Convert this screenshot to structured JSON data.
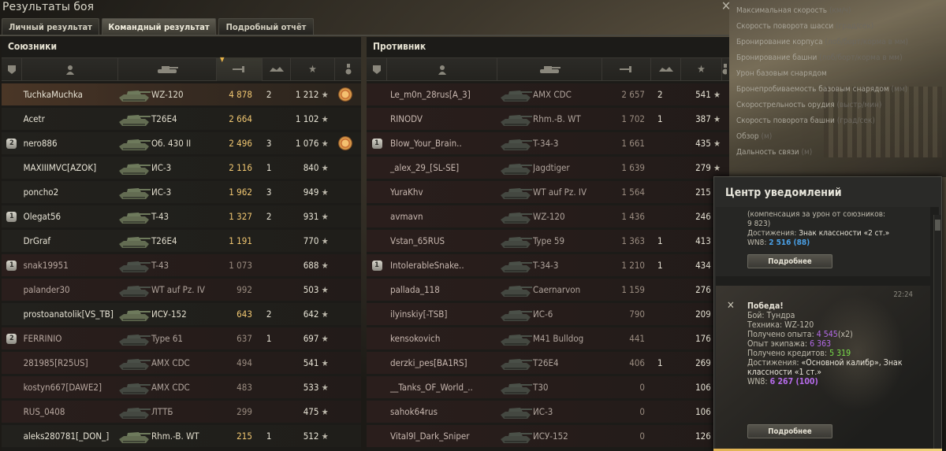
{
  "window": {
    "title": "Результаты боя",
    "close_icon": "✕"
  },
  "tabs": [
    {
      "label": "Личный результат"
    },
    {
      "label": "Командный результат",
      "active": true
    },
    {
      "label": "Подробный отчёт"
    }
  ],
  "allies": {
    "title": "Союзники",
    "rows": [
      {
        "name": "TuchkaMuchka",
        "vehicle": "WZ-120",
        "damage": "4 878",
        "kills": "2",
        "xp": "1 212",
        "badge": "",
        "medal": true,
        "highlight": "me"
      },
      {
        "name": "Acetr",
        "vehicle": "T26E4",
        "damage": "2 664",
        "kills": "",
        "xp": "1 102",
        "badge": "",
        "medal": false,
        "highlight": ""
      },
      {
        "name": "nero886",
        "vehicle": "Об. 430 II",
        "damage": "2 496",
        "kills": "3",
        "xp": "1 076",
        "badge": "2",
        "medal": true,
        "highlight": ""
      },
      {
        "name": "MAXIIIMVC[AZOK]",
        "vehicle": "ИС-3",
        "damage": "2 116",
        "kills": "1",
        "xp": "840",
        "badge": "",
        "medal": false,
        "highlight": ""
      },
      {
        "name": "poncho2",
        "vehicle": "ИС-3",
        "damage": "1 962",
        "kills": "3",
        "xp": "949",
        "badge": "",
        "medal": false,
        "highlight": ""
      },
      {
        "name": "Olegat56",
        "vehicle": "T-43",
        "damage": "1 327",
        "kills": "2",
        "xp": "931",
        "badge": "1",
        "medal": false,
        "highlight": ""
      },
      {
        "name": "DrGraf",
        "vehicle": "T26E4",
        "damage": "1 191",
        "kills": "",
        "xp": "770",
        "badge": "",
        "medal": false,
        "highlight": ""
      },
      {
        "name": "snak19951",
        "vehicle": "T-43",
        "damage": "1 073",
        "kills": "",
        "xp": "688",
        "badge": "1",
        "medal": false,
        "highlight": "dead"
      },
      {
        "name": "palander30",
        "vehicle": "WT auf Pz. IV",
        "damage": "992",
        "kills": "",
        "xp": "503",
        "badge": "",
        "medal": false,
        "highlight": "dead"
      },
      {
        "name": "prostoanatolik[VS_TB]",
        "vehicle": "ИСУ-152",
        "damage": "643",
        "kills": "2",
        "xp": "642",
        "badge": "",
        "medal": false,
        "highlight": ""
      },
      {
        "name": "FERRINIO",
        "vehicle": "Type 61",
        "damage": "637",
        "kills": "1",
        "xp": "697",
        "badge": "2",
        "medal": false,
        "highlight": "dead"
      },
      {
        "name": "281985[R25US]",
        "vehicle": "AMX CDC",
        "damage": "494",
        "kills": "",
        "xp": "541",
        "badge": "",
        "medal": false,
        "highlight": "dead"
      },
      {
        "name": "kostyn667[DAWE2]",
        "vehicle": "AMX CDC",
        "damage": "483",
        "kills": "",
        "xp": "533",
        "badge": "",
        "medal": false,
        "highlight": "dead"
      },
      {
        "name": "RUS_0408",
        "vehicle": "ЛТТБ",
        "damage": "299",
        "kills": "",
        "xp": "475",
        "badge": "",
        "medal": false,
        "highlight": "dead"
      },
      {
        "name": "aleks280781[_DON_]",
        "vehicle": "Rhm.-B. WT",
        "damage": "215",
        "kills": "1",
        "xp": "512",
        "badge": "",
        "medal": false,
        "highlight": ""
      }
    ]
  },
  "enemies": {
    "title": "Противник",
    "rows": [
      {
        "name": "Le_m0n_28rus[A_3]",
        "vehicle": "AMX CDC",
        "damage": "2 657",
        "kills": "2",
        "xp": "541",
        "badge": "",
        "highlight": "dead"
      },
      {
        "name": "RINODV",
        "vehicle": "Rhm.-B. WT",
        "damage": "1 702",
        "kills": "1",
        "xp": "387",
        "badge": "",
        "highlight": "dead"
      },
      {
        "name": "Blow_Your_Brain..",
        "vehicle": "T-34-3",
        "damage": "1 661",
        "kills": "",
        "xp": "435",
        "badge": "1",
        "highlight": "dead"
      },
      {
        "name": "_alex_29_[SL-SE]",
        "vehicle": "Jagdtiger",
        "damage": "1 639",
        "kills": "",
        "xp": "279",
        "badge": "",
        "highlight": "dead"
      },
      {
        "name": "YuraKhv",
        "vehicle": "WT auf Pz. IV",
        "damage": "1 564",
        "kills": "",
        "xp": "215",
        "badge": "",
        "highlight": "dead"
      },
      {
        "name": "avmavn",
        "vehicle": "WZ-120",
        "damage": "1 436",
        "kills": "",
        "xp": "246",
        "badge": "",
        "highlight": "dead"
      },
      {
        "name": "Vstan_65RUS",
        "vehicle": "Type 59",
        "damage": "1 363",
        "kills": "1",
        "xp": "413",
        "badge": "",
        "highlight": "dead"
      },
      {
        "name": "IntolerableSnake..",
        "vehicle": "T-34-3",
        "damage": "1 210",
        "kills": "1",
        "xp": "434",
        "badge": "1",
        "highlight": "dead"
      },
      {
        "name": "pallada_118",
        "vehicle": "Caernarvon",
        "damage": "1 159",
        "kills": "",
        "xp": "276",
        "badge": "",
        "highlight": "dead"
      },
      {
        "name": "ilyinskiy[-TSB]",
        "vehicle": "ИС-6",
        "damage": "790",
        "kills": "",
        "xp": "209",
        "badge": "",
        "highlight": "dead"
      },
      {
        "name": "kensokovich",
        "vehicle": "M41 Bulldog",
        "damage": "441",
        "kills": "",
        "xp": "176",
        "badge": "",
        "highlight": "dead"
      },
      {
        "name": "derzki_pes[BA1RS]",
        "vehicle": "T26E4",
        "damage": "406",
        "kills": "1",
        "xp": "269",
        "badge": "",
        "highlight": "dead"
      },
      {
        "name": "__Tanks_OF_World_..",
        "vehicle": "T30",
        "damage": "0",
        "kills": "",
        "xp": "106",
        "badge": "",
        "highlight": "dead"
      },
      {
        "name": "sahok64rus",
        "vehicle": "ИС-3",
        "damage": "0",
        "kills": "",
        "xp": "106",
        "badge": "",
        "highlight": "dead"
      },
      {
        "name": "Vital9l_Dark_Sniper",
        "vehicle": "ИСУ-152",
        "damage": "0",
        "kills": "",
        "xp": "126",
        "badge": "",
        "highlight": "dead"
      }
    ]
  },
  "stats_list": [
    {
      "label": "Максимальная скорость",
      "unit": "(км/ч)"
    },
    {
      "label": "Скорость поворота шасси",
      "unit": "(град/сек)"
    },
    {
      "label": "Бронирование корпуса",
      "unit": "(лоб/борт/корма в мм)"
    },
    {
      "label": "Бронирование башни",
      "unit": "(лоб/борт/корма в мм)"
    },
    {
      "label": "Урон базовым снарядом",
      "unit": ""
    },
    {
      "label": "Бронепробиваемость базовым снарядом",
      "unit": "(мм)"
    },
    {
      "label": "Скорострельность орудия",
      "unit": "(выстр/мин)"
    },
    {
      "label": "Скорость поворота башни",
      "unit": "(град/сек)"
    },
    {
      "label": "Обзор",
      "unit": "(м)"
    },
    {
      "label": "Дальность связи",
      "unit": "(м)"
    }
  ],
  "notifications": {
    "title": "Центр уведомлений",
    "msg1": {
      "line1": "(компенсация за урон от союзников:",
      "line2": "9 823)",
      "achievements_label": "Достижения:",
      "achievements": "Знак классности «2 ст.»",
      "wn8_label": "WN8:",
      "wn8": "2 516 (88)",
      "button": "Подробнее"
    },
    "msg2": {
      "time": "22:24",
      "title": "Победа!",
      "battle_label": "Бой:",
      "battle": "Тундра",
      "vehicle_label": "Техника:",
      "vehicle": "WZ-120",
      "xp_label": "Получено опыта:",
      "xp": "4 545",
      "xp_mult": "(x2)",
      "crew_label": "Опыт экипажа:",
      "crew": "6 363",
      "credits_label": "Получено кредитов:",
      "credits": "5 319",
      "achievements_label": "Достижения:",
      "achievements": "«Основной калибр», Знак классности «1 ст.»",
      "wn8_label": "WN8:",
      "wn8": "6 267 (100)",
      "button": "Подробнее"
    }
  },
  "colors": {
    "damage": "#f2c872",
    "wn8_blue": "#4aa0e6",
    "xp_purple": "#b46ae8",
    "credits_green": "#7ae04a"
  }
}
